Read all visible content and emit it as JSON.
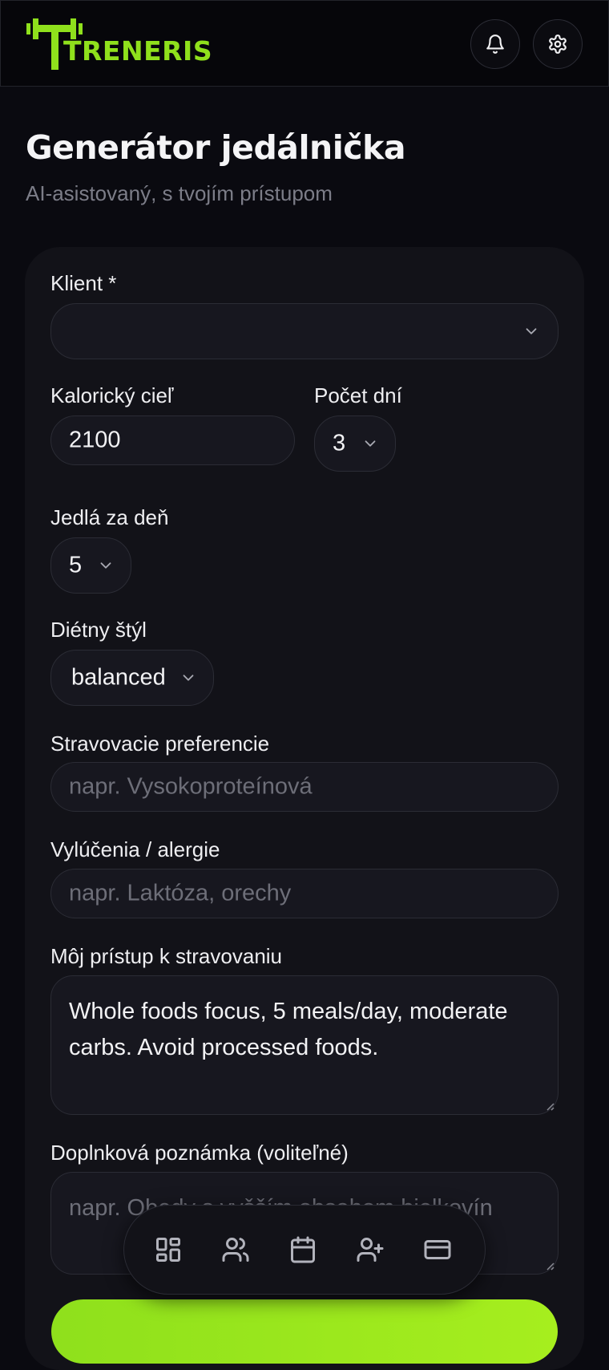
{
  "header": {
    "brand": "TRENERIS",
    "brand_color": "#8fe01c",
    "notifications_icon": "bell-icon",
    "settings_icon": "gear-icon"
  },
  "page": {
    "title": "Generátor jedálnička",
    "subtitle": "AI-asistovaný, s tvojím prístupom"
  },
  "form": {
    "client": {
      "label": "Klient *",
      "value": ""
    },
    "calorie_goal": {
      "label": "Kalorický cieľ",
      "value": "2100"
    },
    "days": {
      "label": "Počet dní",
      "value": "3"
    },
    "meals_per_day": {
      "label": "Jedlá za deň",
      "value": "5"
    },
    "diet_style": {
      "label": "Diétny štýl",
      "value": "balanced"
    },
    "preferences": {
      "label": "Stravovacie preferencie",
      "placeholder": "napr. Vysokoproteínová"
    },
    "exclusions": {
      "label": "Vylúčenia / alergie",
      "placeholder": "napr. Laktóza, orechy"
    },
    "approach": {
      "label": "Môj prístup k stravovaniu",
      "value": "Whole foods focus, 5 meals/day, moderate carbs. Avoid processed foods."
    },
    "note": {
      "label": "Doplnková poznámka (voliteľné)",
      "placeholder": "napr. Obedy s vyšším obsahom bielkovín"
    }
  },
  "bottom_nav": {
    "items": [
      {
        "icon": "dashboard-icon"
      },
      {
        "icon": "users-icon"
      },
      {
        "icon": "calendar-icon"
      },
      {
        "icon": "user-plus-icon"
      },
      {
        "icon": "credit-card-icon"
      }
    ]
  },
  "colors": {
    "background": "#0a0a10",
    "card": "#121218",
    "accent": "#8fe01c"
  }
}
